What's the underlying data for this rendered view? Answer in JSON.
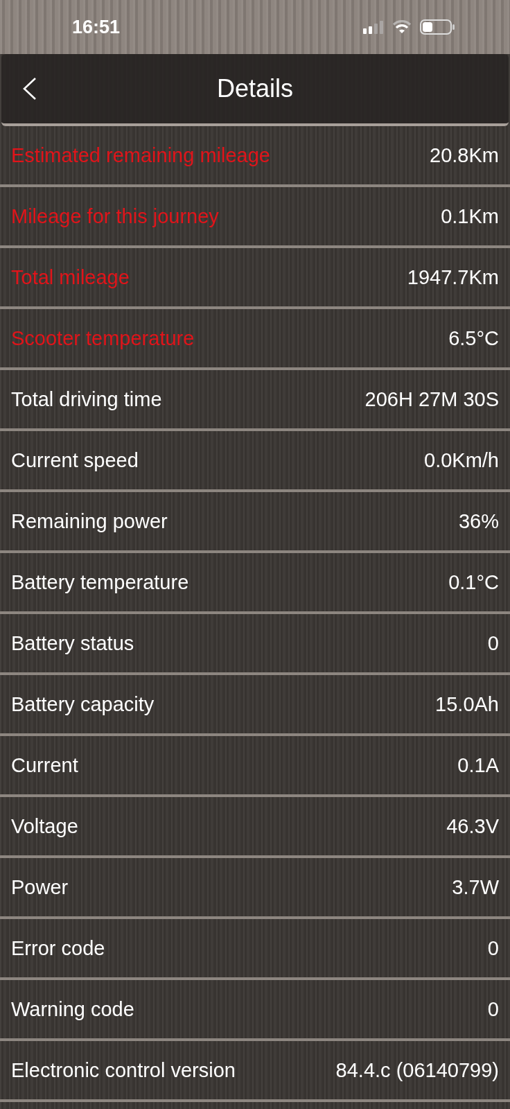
{
  "status_bar": {
    "time": "16:51"
  },
  "header": {
    "title": "Details"
  },
  "rows": [
    {
      "label": "Estimated remaining mileage",
      "value": "20.8Km",
      "alert": true
    },
    {
      "label": "Mileage for this journey",
      "value": "0.1Km",
      "alert": true
    },
    {
      "label": "Total mileage",
      "value": "1947.7Km",
      "alert": true
    },
    {
      "label": "Scooter temperature",
      "value": "6.5°C",
      "alert": true
    },
    {
      "label": "Total driving time",
      "value": "206H 27M 30S",
      "alert": false
    },
    {
      "label": "Current speed",
      "value": "0.0Km/h",
      "alert": false
    },
    {
      "label": "Remaining power",
      "value": "36%",
      "alert": false
    },
    {
      "label": "Battery temperature",
      "value": "0.1°C",
      "alert": false
    },
    {
      "label": "Battery status",
      "value": "0",
      "alert": false
    },
    {
      "label": "Battery capacity",
      "value": "15.0Ah",
      "alert": false
    },
    {
      "label": "Current",
      "value": "0.1A",
      "alert": false
    },
    {
      "label": "Voltage",
      "value": "46.3V",
      "alert": false
    },
    {
      "label": "Power",
      "value": "3.7W",
      "alert": false
    },
    {
      "label": "Error code",
      "value": "0",
      "alert": false
    },
    {
      "label": "Warning code",
      "value": "0",
      "alert": false
    },
    {
      "label": "Electronic control version",
      "value": "84.4.c (06140799)",
      "alert": false
    }
  ]
}
